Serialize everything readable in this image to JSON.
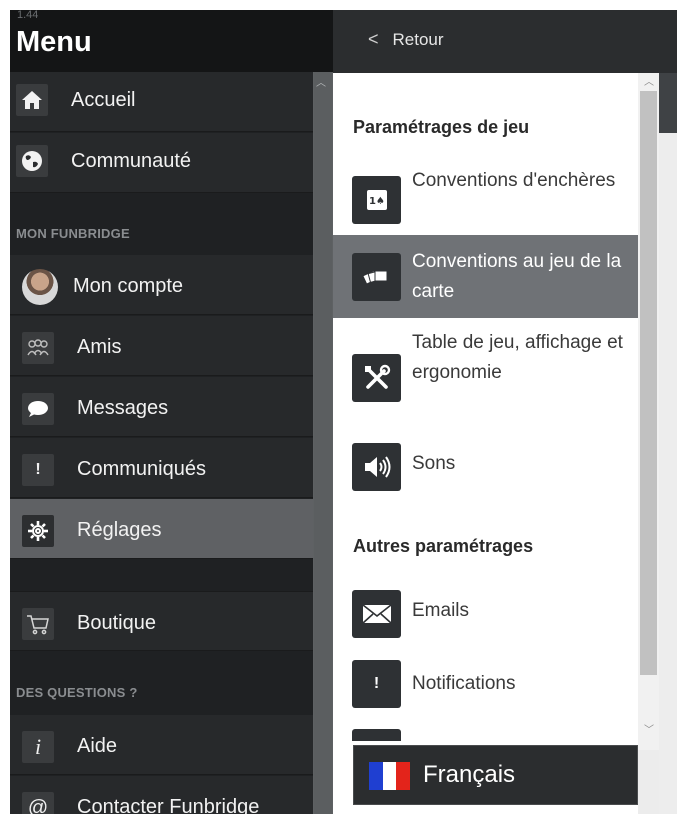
{
  "app": {
    "version": "1.44"
  },
  "menu": {
    "title": "Menu",
    "items_top": [
      {
        "label": "Accueil",
        "icon": "home-icon"
      },
      {
        "label": "Communauté",
        "icon": "globe-icon"
      }
    ],
    "section_account": "MON FUNBRIDGE",
    "items_account": [
      {
        "label": "Mon compte",
        "icon": "avatar"
      },
      {
        "label": "Amis",
        "icon": "friends-icon"
      },
      {
        "label": "Messages",
        "icon": "chat-bubble-icon"
      },
      {
        "label": "Communiqués",
        "icon": "exclamation-icon"
      },
      {
        "label": "Réglages",
        "icon": "gear-icon",
        "active": true
      }
    ],
    "items_shop": [
      {
        "label": "Boutique",
        "icon": "cart-icon"
      }
    ],
    "section_help": "DES QUESTIONS ?",
    "items_help": [
      {
        "label": "Aide",
        "icon": "info-icon"
      },
      {
        "label": "Contacter Funbridge",
        "icon": "at-icon"
      }
    ]
  },
  "settings": {
    "back_label": "Retour",
    "section_game": "Paramétrages de jeu",
    "game_items": [
      {
        "label": "Conventions d'enchères",
        "icon": "bidding-card-icon"
      },
      {
        "label": "Conventions au jeu de la carte",
        "icon": "cards-fan-icon",
        "active": true
      },
      {
        "label": "Table de jeu, affichage et ergonomie",
        "icon": "tools-icon"
      },
      {
        "label": "Sons",
        "icon": "speaker-icon"
      }
    ],
    "section_other": "Autres paramétrages",
    "other_items": [
      {
        "label": "Emails",
        "icon": "envelope-icon"
      },
      {
        "label": "Notifications",
        "icon": "exclamation-icon"
      }
    ],
    "language": {
      "label": "Français",
      "flag_colors": [
        "#1f3fd1",
        "#ffffff",
        "#e3241b"
      ]
    }
  }
}
